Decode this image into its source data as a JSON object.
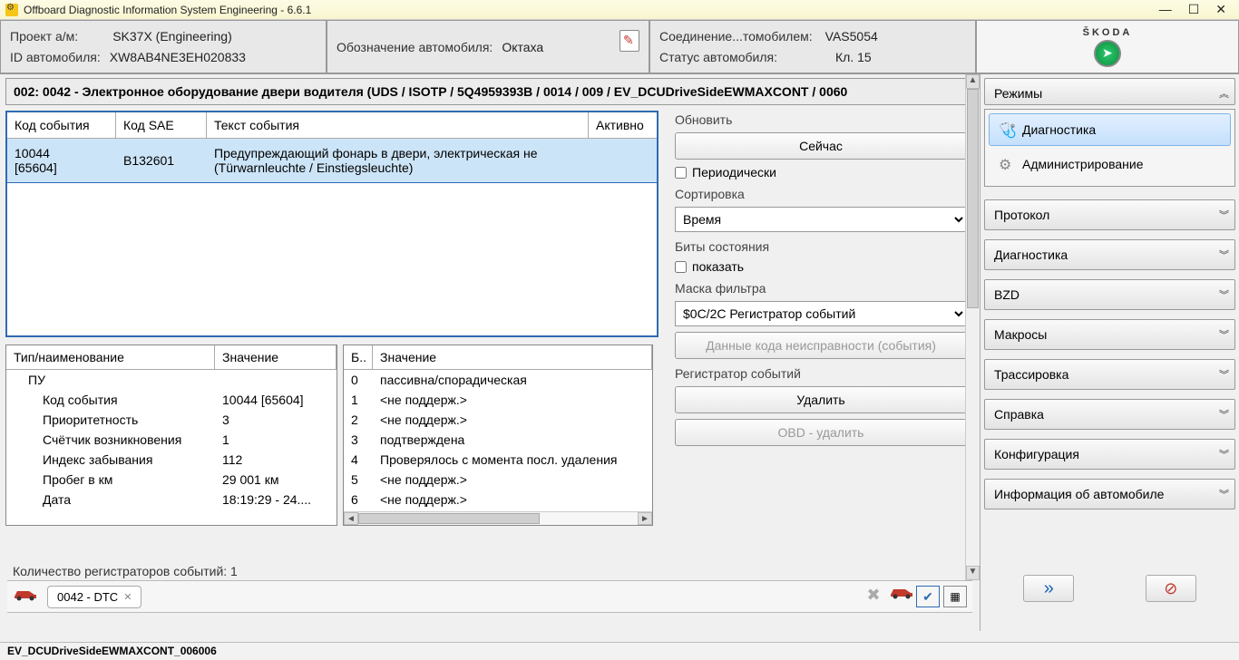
{
  "window": {
    "title": "Offboard Diagnostic Information System Engineering - 6.6.1"
  },
  "header": {
    "project_lbl": "Проект а/м:",
    "project_val": "SK37X     (Engineering)",
    "vehid_lbl": "ID автомобиля:",
    "vehid_val": "XW8AB4NE3EH020833",
    "designation_lbl": "Обозначение автомобиля:",
    "designation_val": "Октаха",
    "conn_lbl": "Соединение...томобилем:",
    "conn_val": "VAS5054",
    "status_lbl": "Статус автомобиля:",
    "status_val": "Кл. 15",
    "brand": "ŠKODA"
  },
  "module_title": "002: 0042 - Электронное оборудование двери водителя  (UDS / ISOTP / 5Q4959393B  / 0014 / 009 / EV_DCUDriveSideEWMAXCONT / 0060",
  "events": {
    "cols": {
      "code": "Код события",
      "sae": "Код SAE",
      "text": "Текст события",
      "active": "Активно"
    },
    "rows": [
      {
        "code": "10044\n[65604]",
        "sae": "B132601",
        "text": "Предупреждающий фонарь в двери, электрическая не\n(Türwarnleuchte / Einstiegsleuchte)"
      }
    ]
  },
  "ctrl": {
    "update": "Обновить",
    "now": "Сейчас",
    "periodic": "Периодически",
    "sort": "Сортировка",
    "sort_val": "Время",
    "statusbits": "Биты состояния",
    "show": "показать",
    "filtermask": "Маска фильтра",
    "filtermask_val": "$0C/2C Регистратор событий",
    "dtc_data": "Данные кода неисправности (события)",
    "recorder": "Регистратор событий",
    "delete": "Удалить",
    "obd_delete": "OBD - удалить"
  },
  "detail1": {
    "h1": "Тип/наименование",
    "h2": "Значение",
    "rows": [
      [
        "ПУ",
        ""
      ],
      [
        "Код события",
        "10044 [65604]"
      ],
      [
        "Приоритетность",
        "3"
      ],
      [
        "Счётчик возникновения",
        "1"
      ],
      [
        "Индекс забывания",
        "112"
      ],
      [
        "Пробег в км",
        "29 001 км"
      ],
      [
        "Дата",
        "18:19:29 - 24...."
      ]
    ]
  },
  "detail2": {
    "h1": "Б..",
    "h2": "Значение",
    "rows": [
      [
        "0",
        "пассивна/спорадическая"
      ],
      [
        "1",
        "<не поддерж.>"
      ],
      [
        "2",
        "<не поддерж.>"
      ],
      [
        "3",
        "подтверждена"
      ],
      [
        "4",
        "Проверялось с момента посл. удаления"
      ],
      [
        "5",
        "<не поддерж.>"
      ],
      [
        "6",
        "<не поддерж.>"
      ]
    ]
  },
  "summary": "Количество регистраторов событий:   1",
  "bottom_tab": "0042 - DTC",
  "statusbar": "EV_DCUDriveSideEWMAXCONT_006006",
  "right": {
    "modes": "Режимы",
    "diag": "Диагностика",
    "admin": "Администрирование",
    "items": [
      "Протокол",
      "Диагностика",
      "BZD",
      "Макросы",
      "Трассировка",
      "Справка",
      "Конфигурация",
      "Информация об автомобиле"
    ]
  }
}
